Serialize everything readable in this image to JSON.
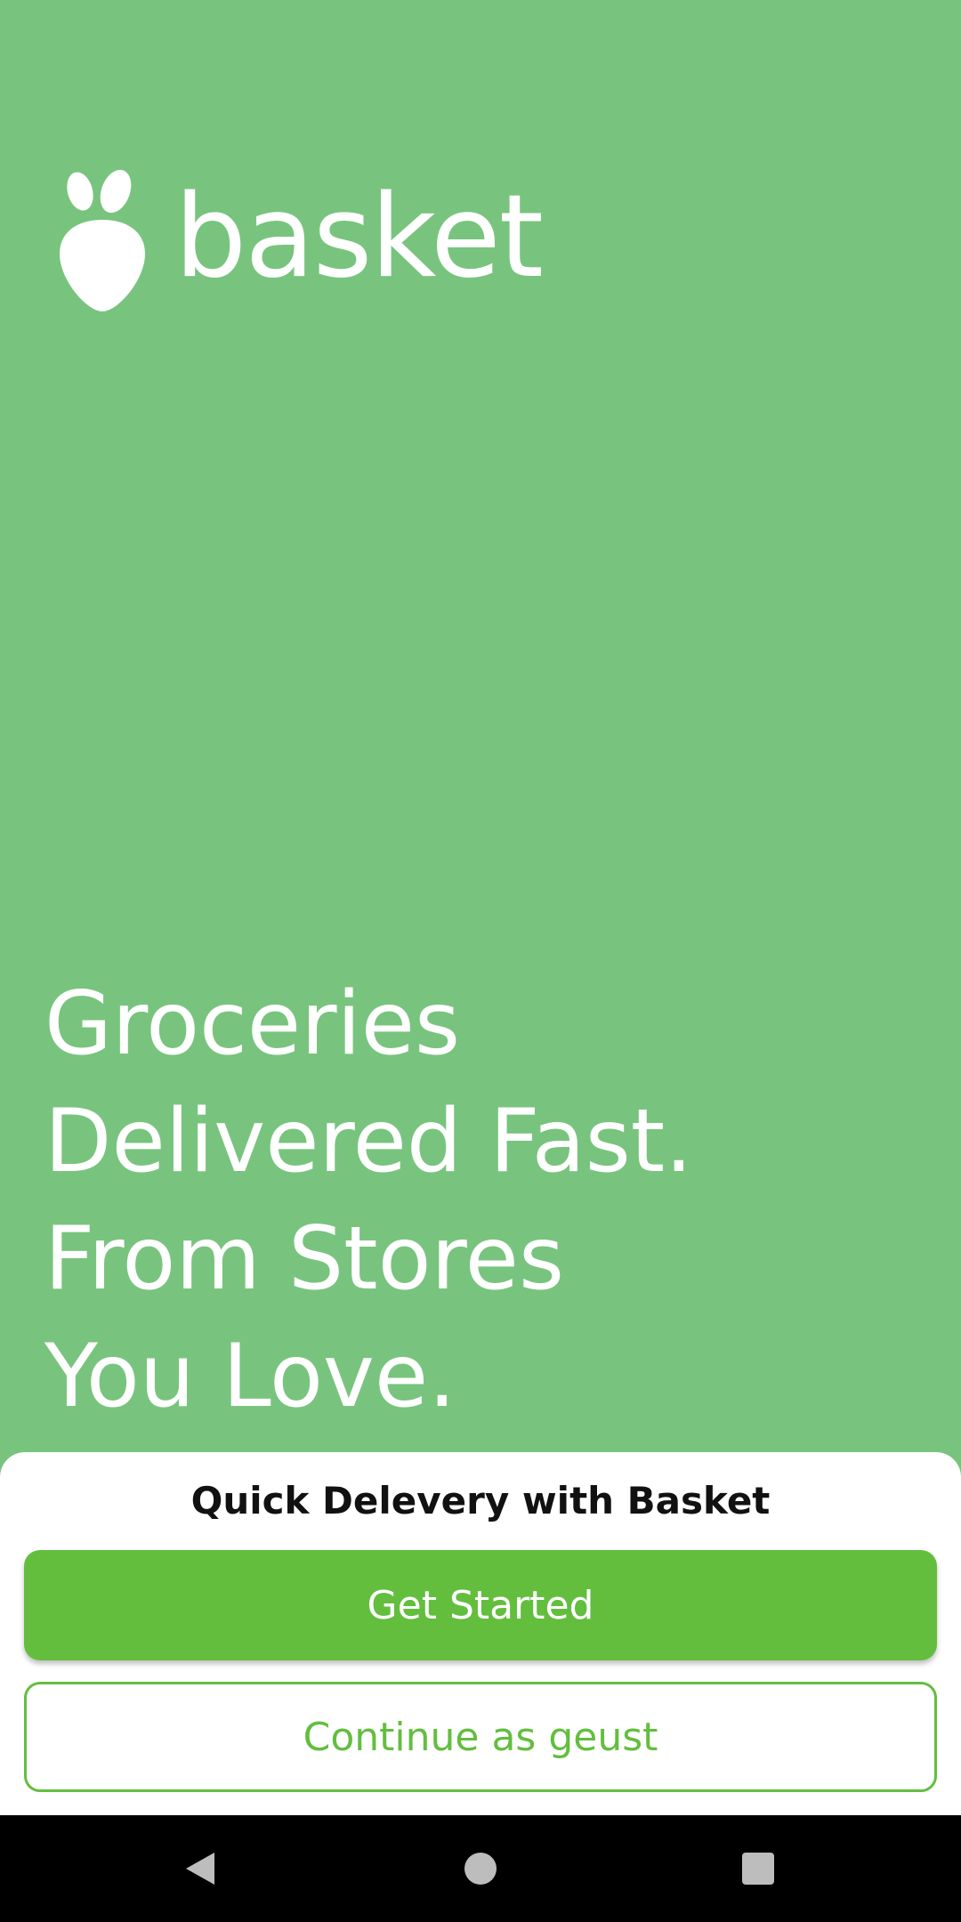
{
  "app": {
    "brand_name": "basket",
    "brand_color": "#78c47e",
    "accent_color": "#63be3e"
  },
  "splash": {
    "logo_icon": "carrot-logo-icon",
    "headline_lines": [
      "Groceries",
      "Delivered Fast.",
      "From Stores",
      "You Love."
    ]
  },
  "sheet": {
    "title": "Quick Delevery with Basket",
    "primary_button_label": "Get Started",
    "secondary_button_label": "Continue as geust"
  },
  "system_nav": {
    "back_icon": "back-triangle-icon",
    "home_icon": "home-circle-icon",
    "recents_icon": "recents-square-icon"
  }
}
